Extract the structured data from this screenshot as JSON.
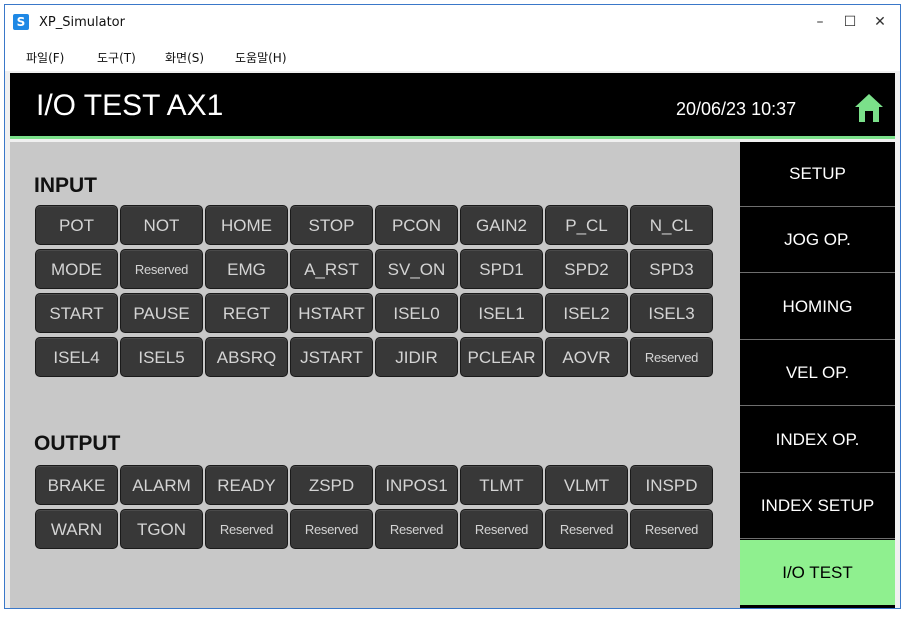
{
  "window": {
    "title": "XP_Simulator",
    "icon_letter": "S",
    "minimize": "–",
    "maximize": "☐",
    "close": "✕"
  },
  "menu": [
    "파일(F)",
    "도구(T)",
    "화면(S)",
    "도움말(H)"
  ],
  "header": {
    "title": "I/O TEST AX1",
    "datetime": "20/06/23 10:37",
    "accent_color": "#7be08a"
  },
  "input": {
    "title": "INPUT",
    "signals": [
      "POT",
      "NOT",
      "HOME",
      "STOP",
      "PCON",
      "GAIN2",
      "P_CL",
      "N_CL",
      "MODE",
      "Reserved",
      "EMG",
      "A_RST",
      "SV_ON",
      "SPD1",
      "SPD2",
      "SPD3",
      "START",
      "PAUSE",
      "REGT",
      "HSTART",
      "ISEL0",
      "ISEL1",
      "ISEL2",
      "ISEL3",
      "ISEL4",
      "ISEL5",
      "ABSRQ",
      "JSTART",
      "JIDIR",
      "PCLEAR",
      "AOVR",
      "Reserved"
    ]
  },
  "output": {
    "title": "OUTPUT",
    "signals": [
      "BRAKE",
      "ALARM",
      "READY",
      "ZSPD",
      "INPOS1",
      "TLMT",
      "VLMT",
      "INSPD",
      "WARN",
      "TGON",
      "Reserved",
      "Reserved",
      "Reserved",
      "Reserved",
      "Reserved",
      "Reserved"
    ]
  },
  "nav": {
    "items": [
      "SETUP",
      "JOG OP.",
      "HOMING",
      "VEL OP.",
      "INDEX OP.",
      "INDEX SETUP",
      "I/O TEST"
    ],
    "active_index": 6,
    "active_color": "#8ff08f"
  },
  "icons": {
    "home": "home-icon"
  }
}
